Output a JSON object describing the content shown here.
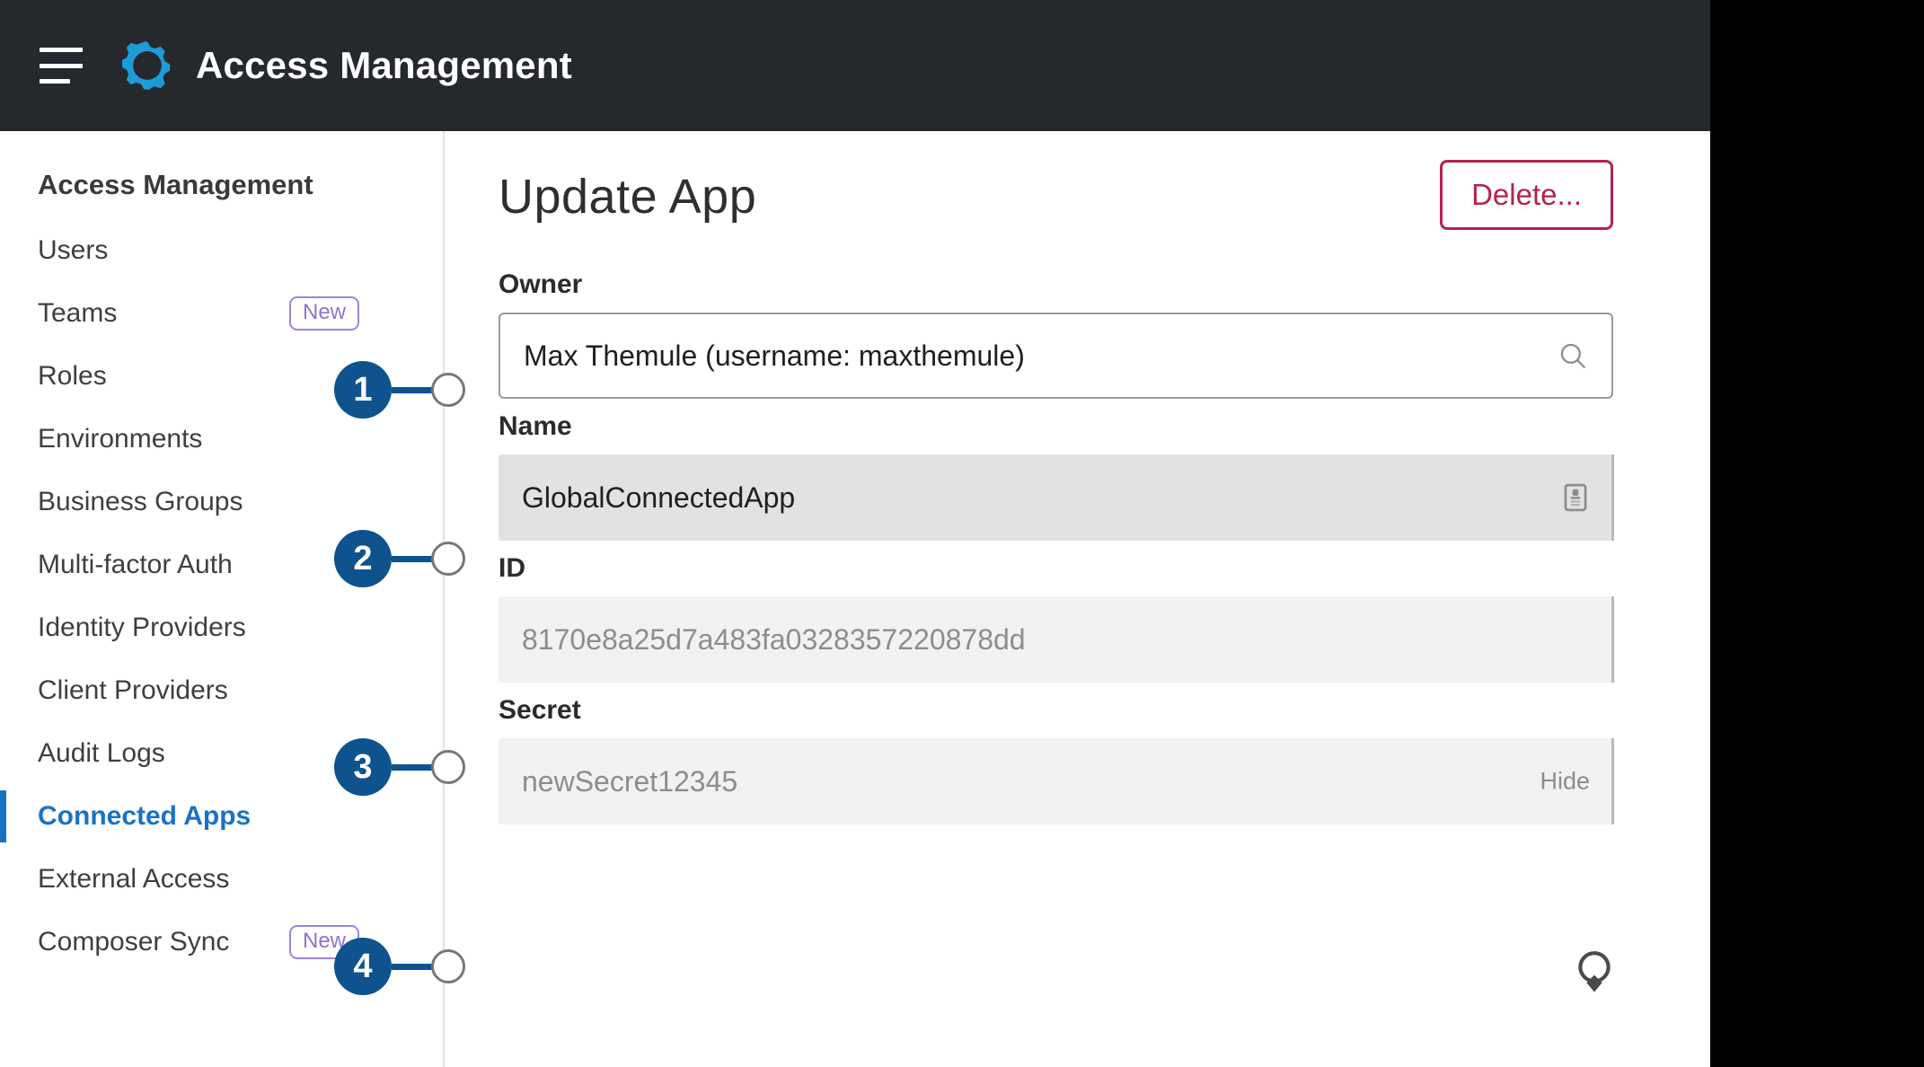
{
  "header": {
    "menu_icon": "hamburger-menu-icon",
    "logo_icon": "gear-icon",
    "title": "Access Management",
    "background": "#25282d",
    "logo_color": "#1e9ad6"
  },
  "sidebar": {
    "heading": "Access Management",
    "active_color": "#1b72c4",
    "badge_color": "#9f84d8",
    "items": [
      {
        "label": "Users",
        "badge": null,
        "active": false
      },
      {
        "label": "Teams",
        "badge": "New",
        "active": false
      },
      {
        "label": "Roles",
        "badge": null,
        "active": false
      },
      {
        "label": "Environments",
        "badge": null,
        "active": false
      },
      {
        "label": "Business Groups",
        "badge": null,
        "active": false
      },
      {
        "label": "Multi-factor Auth",
        "badge": null,
        "active": false
      },
      {
        "label": "Identity Providers",
        "badge": null,
        "active": false
      },
      {
        "label": "Client Providers",
        "badge": null,
        "active": false
      },
      {
        "label": "Audit Logs",
        "badge": null,
        "active": false
      },
      {
        "label": "Connected Apps",
        "badge": null,
        "active": true
      },
      {
        "label": "External Access",
        "badge": null,
        "active": false
      },
      {
        "label": "Composer Sync",
        "badge": "New",
        "active": false
      }
    ]
  },
  "main": {
    "title": "Update App",
    "delete_label": "Delete...",
    "delete_color": "#b4224a",
    "fields": [
      {
        "label": "Owner",
        "value": "Max Themule (username: maxthemule)",
        "affix_icon": "search-icon",
        "affix_text": null,
        "style": "editable"
      },
      {
        "label": "Name",
        "value": "GlobalConnectedApp",
        "affix_icon": "copy-to-clipboard-icon",
        "affix_text": null,
        "style": "readonly-dark"
      },
      {
        "label": "ID",
        "value": "8170e8a25d7a483fa0328357220878dd",
        "affix_icon": null,
        "affix_text": null,
        "style": "readonly-light"
      },
      {
        "label": "Secret",
        "value": "newSecret12345",
        "affix_icon": null,
        "affix_text": "Hide",
        "style": "readonly-light"
      }
    ]
  },
  "callouts": [
    {
      "number": "1",
      "target_field": "Owner"
    },
    {
      "number": "2",
      "target_field": "Name"
    },
    {
      "number": "3",
      "target_field": "ID"
    },
    {
      "number": "4",
      "target_field": "Secret"
    }
  ]
}
